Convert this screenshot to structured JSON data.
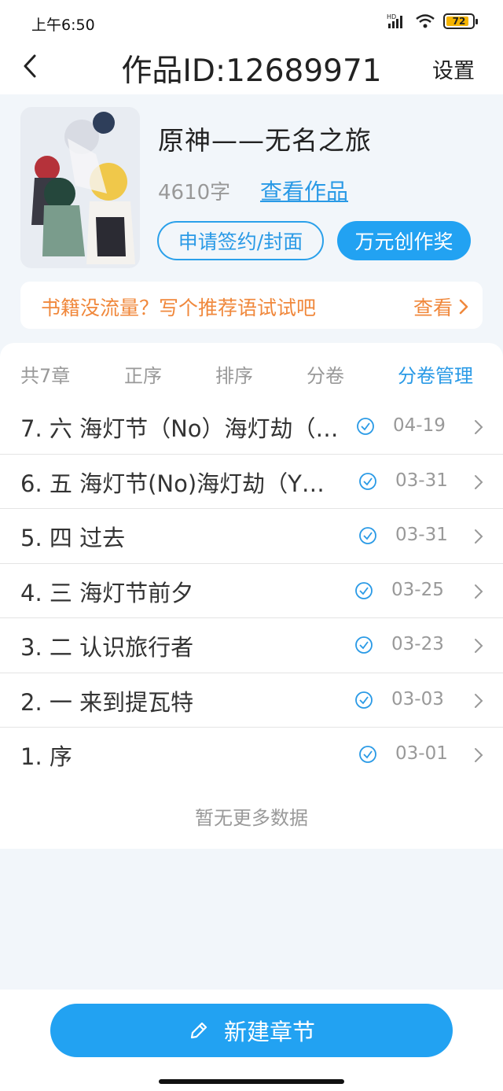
{
  "status_bar": {
    "time": "上午6:50",
    "battery": "72",
    "hd_label": "HD"
  },
  "header": {
    "title": "作品ID:12689971",
    "settings_label": "设置"
  },
  "book": {
    "title": "原神——无名之旅",
    "word_count": "4610字",
    "view_link": "查看作品",
    "sign_button": "申请签约/封面",
    "award_button": "万元创作奖"
  },
  "promo": {
    "text": "书籍没流量？写个推荐语试试吧",
    "action": "查看"
  },
  "toolbar": {
    "count": "共7章",
    "order": "正序",
    "sort": "排序",
    "volume": "分卷",
    "volume_manage": "分卷管理"
  },
  "chapters": [
    {
      "title": "7. 六 海灯节（No）海灯劫（…",
      "date": "04-19"
    },
    {
      "title": "6. 五 海灯节(No)海灯劫（Y…",
      "date": "03-31"
    },
    {
      "title": "5. 四 过去",
      "date": "03-31"
    },
    {
      "title": "4. 三 海灯节前夕",
      "date": "03-25"
    },
    {
      "title": "3. 二  认识旅行者",
      "date": "03-23"
    },
    {
      "title": "2. 一 来到提瓦特",
      "date": "03-03"
    },
    {
      "title": "1. 序",
      "date": "03-01"
    }
  ],
  "no_more_text": "暂无更多数据",
  "new_chapter_button": "新建章节",
  "colors": {
    "accent": "#22a2f2",
    "promo": "#f0883c",
    "background": "#f2f6fa"
  },
  "icons": [
    "back-icon",
    "wifi-icon",
    "signal-icon",
    "battery-icon",
    "chevron-right-icon",
    "check-circle-icon",
    "pencil-icon"
  ]
}
